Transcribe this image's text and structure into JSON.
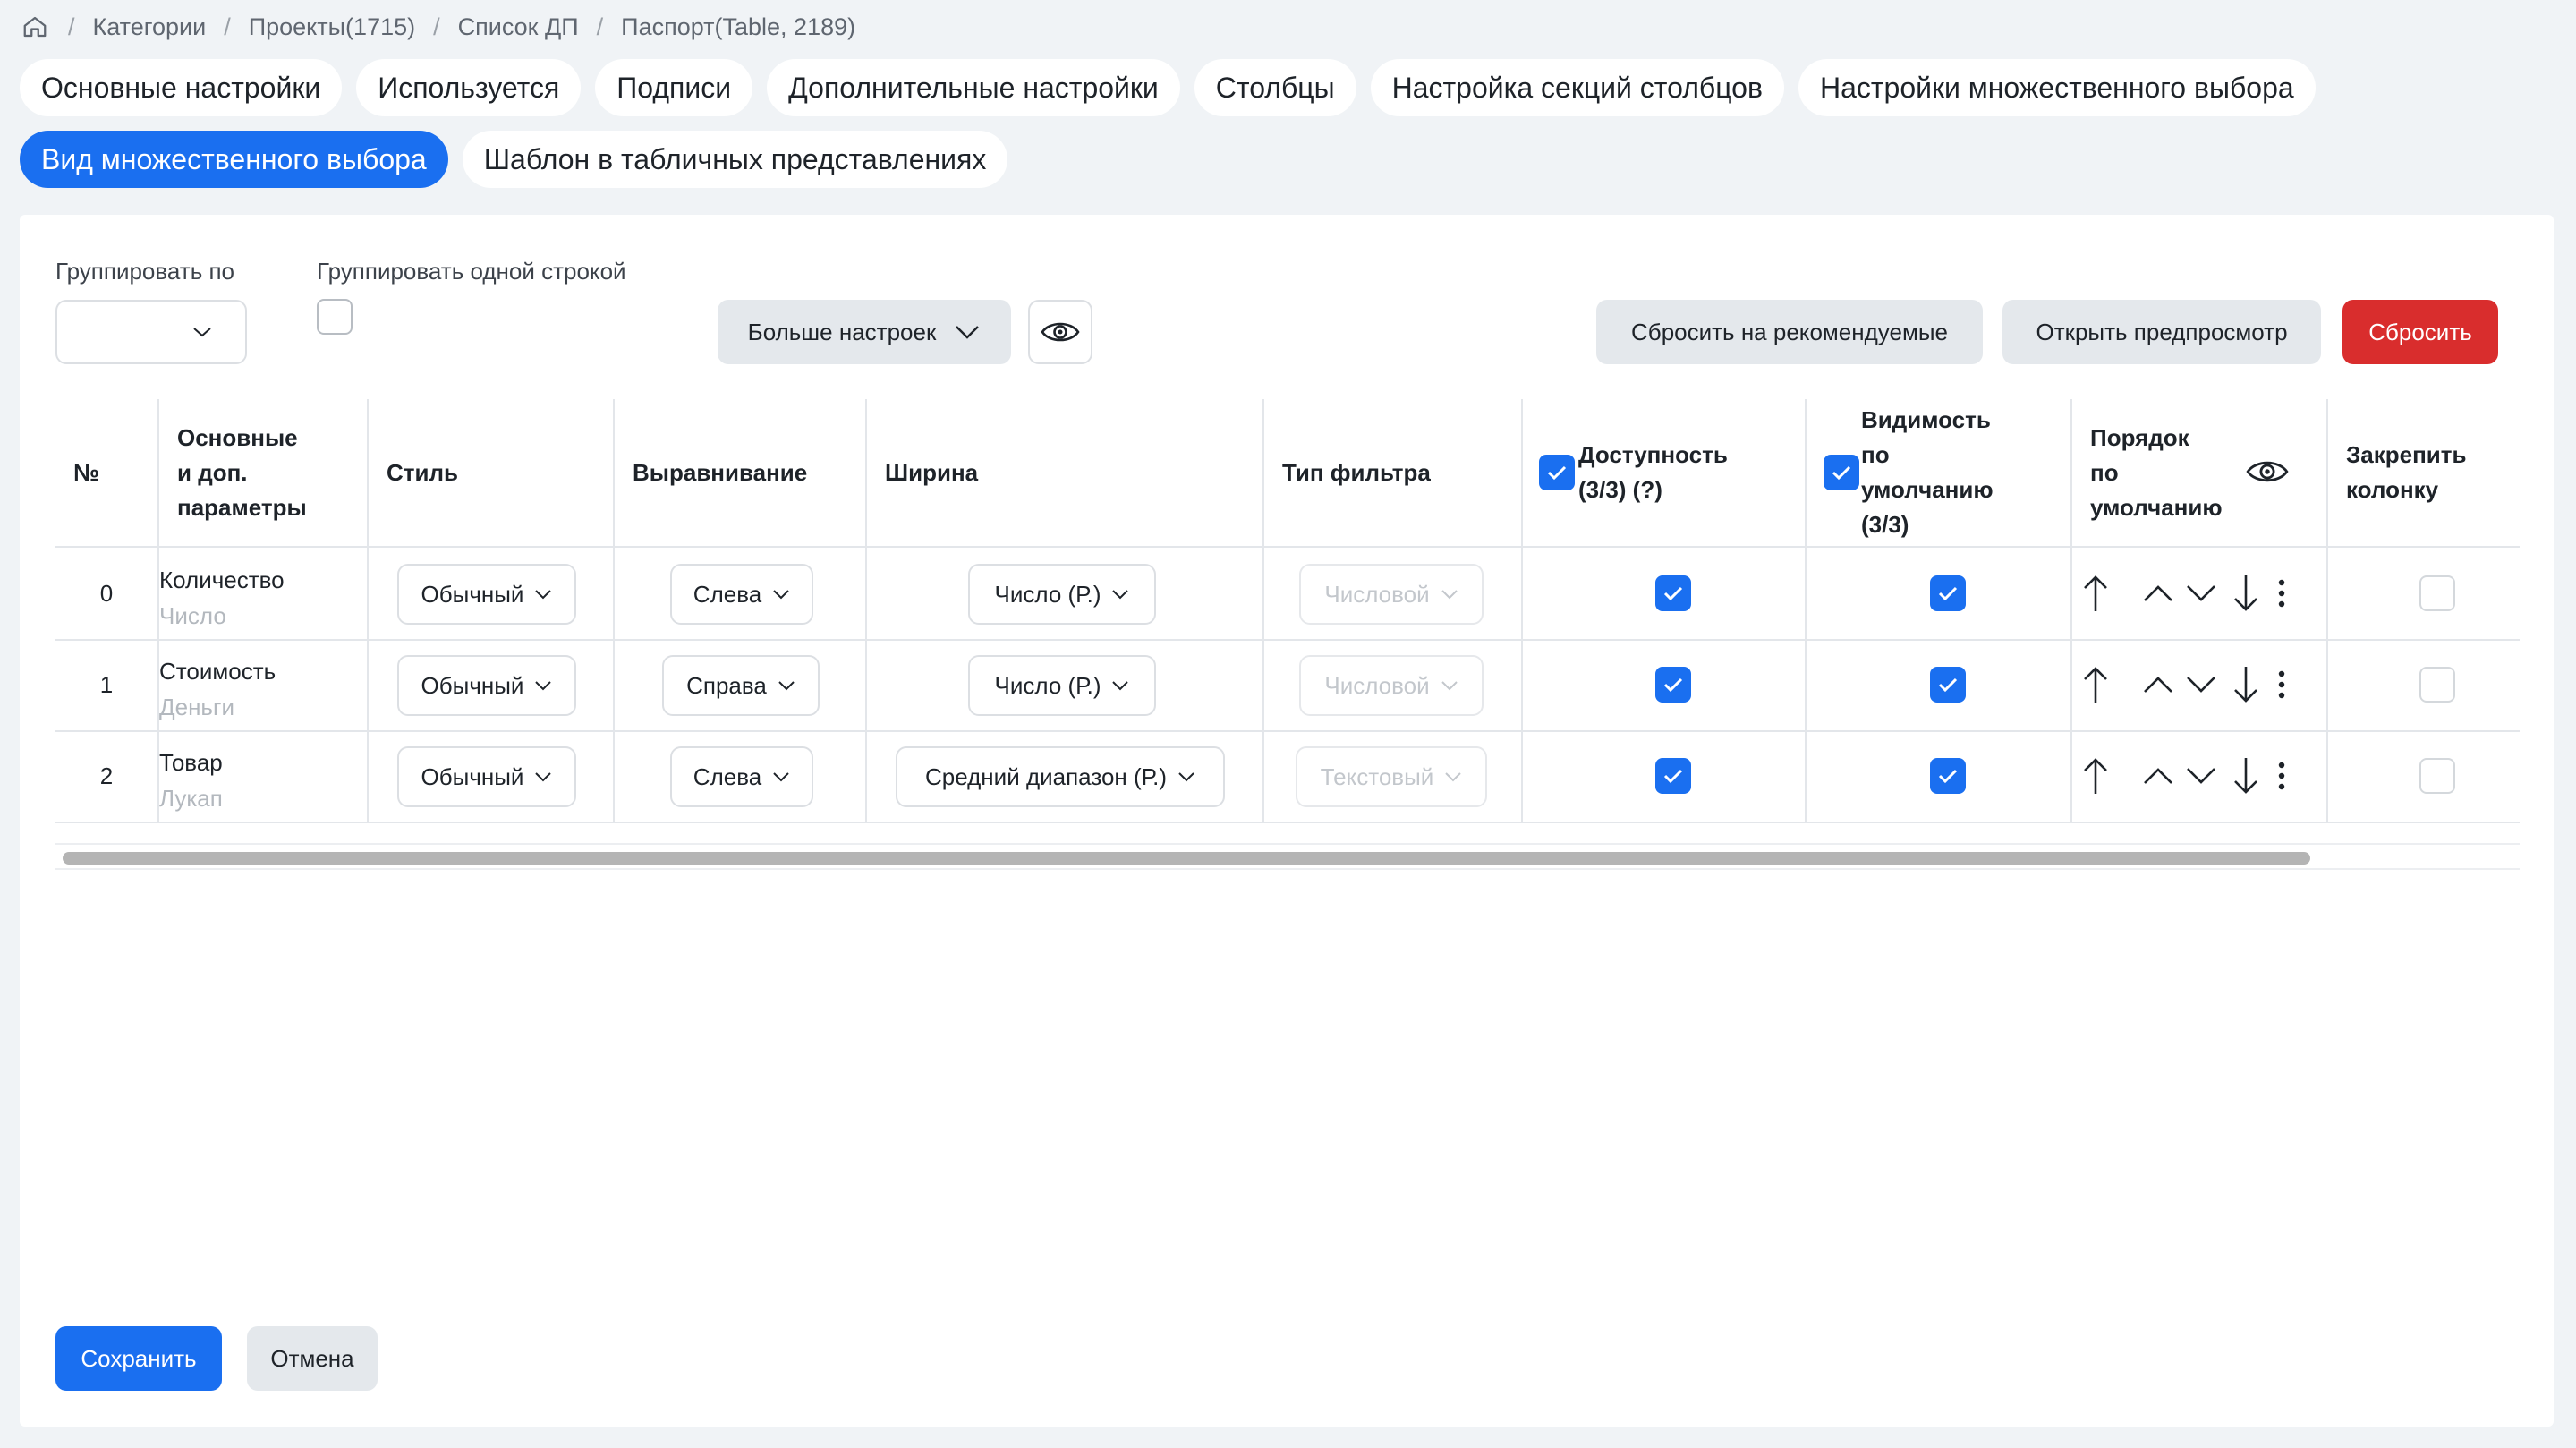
{
  "breadcrumb": {
    "home_icon": "home-icon",
    "items": [
      "Категории",
      "Проекты(1715)",
      "Список ДП",
      "Паспорт(Table, 2189)"
    ]
  },
  "tabs": [
    {
      "label": "Основные настройки",
      "active": false
    },
    {
      "label": "Используется",
      "active": false
    },
    {
      "label": "Подписи",
      "active": false
    },
    {
      "label": "Дополнительные настройки",
      "active": false
    },
    {
      "label": "Столбцы",
      "active": false
    },
    {
      "label": "Настройка секций столбцов",
      "active": false
    },
    {
      "label": "Настройки множественного выбора",
      "active": false
    },
    {
      "label": "Вид множественного выбора",
      "active": true
    },
    {
      "label": "Шаблон в табличных представлениях",
      "active": false
    }
  ],
  "toolbar": {
    "group_by_label": "Группировать по",
    "group_by_value": "",
    "group_one_line_label": "Группировать одной строкой",
    "group_one_line_checked": false,
    "more_settings": "Больше настроек",
    "reset_recommended": "Сбросить на рекомендуемые",
    "open_preview": "Открыть предпросмотр",
    "reset": "Сбросить"
  },
  "table": {
    "headers": {
      "num": "№",
      "params": [
        "Основные",
        "и доп.",
        "параметры"
      ],
      "style": "Стиль",
      "align": "Выравнивание",
      "width": "Ширина",
      "filter": "Тип фильтра",
      "availability": [
        "Доступность",
        "(3/3) (?)"
      ],
      "visibility": [
        "Видимость",
        "по",
        "умолчанию",
        "(3/3)"
      ],
      "order": [
        "Порядок",
        "по",
        "умолчанию"
      ],
      "pin": [
        "Закрепить",
        "колонку"
      ]
    },
    "rows": [
      {
        "num": "0",
        "name": "Количество",
        "type": "Число",
        "style": "Обычный",
        "align": "Слева",
        "width": "Число (Р.)",
        "filter": "Числовой",
        "available": true,
        "visible": true,
        "pinned": false
      },
      {
        "num": "1",
        "name": "Стоимость",
        "type": "Деньги",
        "style": "Обычный",
        "align": "Справа",
        "width": "Число (Р.)",
        "filter": "Числовой",
        "available": true,
        "visible": true,
        "pinned": false
      },
      {
        "num": "2",
        "name": "Товар",
        "type": "Лукап",
        "style": "Обычный",
        "align": "Слева",
        "width": "Средний диапазон (Р.)",
        "filter": "Текстовый",
        "available": true,
        "visible": true,
        "pinned": false
      }
    ]
  },
  "footer": {
    "save": "Сохранить",
    "cancel": "Отмена"
  },
  "colors": {
    "accent": "#1a6ff0",
    "danger": "#d92d2d",
    "background": "#f0f3f6"
  }
}
